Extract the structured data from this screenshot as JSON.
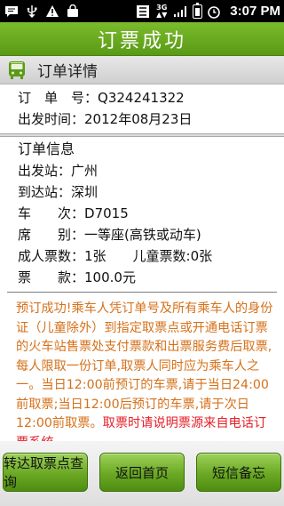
{
  "status_bar": {
    "time": "3:07 PM",
    "icons": [
      "sms-icon",
      "usb-icon",
      "warning-icon",
      "shopping-bag-icon",
      "settings-icon",
      "3g-icon",
      "signal-icon",
      "battery-icon",
      "alarm-icon"
    ]
  },
  "title": "订票成功",
  "order_detail": {
    "header": "订单详情",
    "order_no_label": "订　单　号：",
    "order_no": "Q324241322",
    "depart_time_label": "出发时间：",
    "depart_time": "2012年08月23日"
  },
  "order_info": {
    "header": "订单信息",
    "rows": [
      {
        "label": "出发站：",
        "value": "广州"
      },
      {
        "label": "到达站：",
        "value": "深圳"
      },
      {
        "label": "车　　次：",
        "value": "D7015"
      },
      {
        "label": "席　　别：",
        "value": "一等座(高铁或动车)"
      },
      {
        "label": "成人票数：",
        "value": "1张　　儿童票数:0张"
      },
      {
        "label": "票　　款：",
        "value": "100.0元"
      }
    ]
  },
  "notice": {
    "text": "预订成功!乘车人凭订单号及所有乘车人的身份证（儿童除外）到指定取票点或开通电话订票的火车站售票处支付票款和出票服务费后取票,每人限取一份订单,取票人同时应为乘车人之一。当日12:00前预订的车票,请于当日24:00前取票;当日12:00后预订的车票,请于次日12:00前取票。",
    "highlight": "取票时请说明票源来自电话订票系统。"
  },
  "buttons": {
    "query_pickup": "转达取票点查询",
    "back_home": "返回首页",
    "sms_memo": "短信备忘"
  },
  "colors": {
    "title_bar": "#6aa823",
    "notice_text": "#d5711a",
    "notice_highlight": "#e6202a"
  }
}
